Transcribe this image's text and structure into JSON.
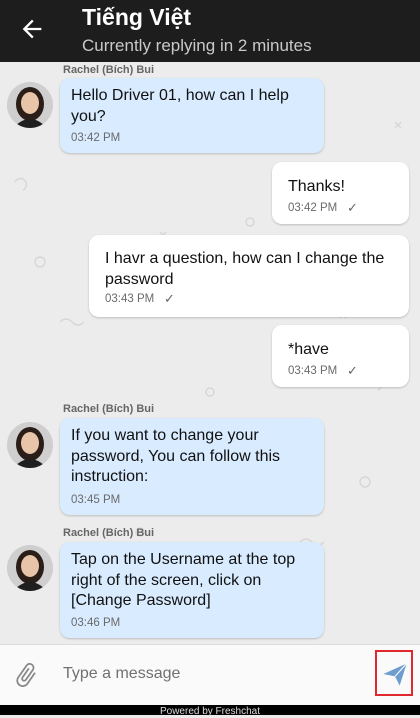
{
  "header": {
    "title": "Tiếng Việt",
    "subtitle": "Currently replying in 2 minutes"
  },
  "messages": [
    {
      "sender": "Rachel (Bích) Bui",
      "text": "Hello Driver 01, how can I help you?",
      "time": "03:42 PM"
    },
    {
      "text": "Thanks!",
      "time": "03:42 PM"
    },
    {
      "text": "I havr a question, how can I change the password",
      "time": "03:43 PM"
    },
    {
      "text": "*have",
      "time": "03:43 PM"
    },
    {
      "sender": "Rachel (Bích) Bui",
      "text": "If you want to change your password, You can follow this instruction:",
      "time": "03:45 PM"
    },
    {
      "sender": "Rachel (Bích) Bui",
      "text": "Tap on the Username at the top right of the screen, click on [Change Password]",
      "time": "03:46 PM"
    }
  ],
  "sent_check": "✓",
  "composer": {
    "placeholder": "Type a message"
  },
  "footer": {
    "text": "Powered by Freshchat"
  },
  "colors": {
    "header_bg": "#1d1d1d",
    "incoming_bubble": "#d8ebff",
    "outgoing_bubble": "#ffffff",
    "send_icon": "#6f9dd0",
    "send_highlight_border": "#e0282e"
  },
  "icons": {
    "back": "arrow-left-icon",
    "attach": "paperclip-icon",
    "send": "paper-plane-icon"
  }
}
